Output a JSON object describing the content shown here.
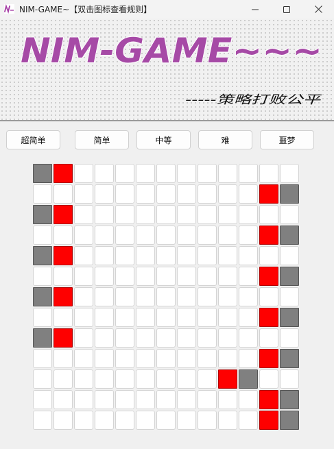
{
  "window": {
    "title": "NIM-GAME~【双击图标查看规则】",
    "icon": "nim-game-logo-icon",
    "controls": [
      "minimize-icon",
      "maximize-icon",
      "close-icon"
    ]
  },
  "banner": {
    "logo_text": "NIM-GAME~~~",
    "slogan": "-----策略打败公平"
  },
  "difficulty": {
    "buttons": [
      {
        "label": "超简单"
      },
      {
        "label": "简单"
      },
      {
        "label": "中等"
      },
      {
        "label": "难"
      },
      {
        "label": "噩梦"
      }
    ]
  },
  "board": {
    "rows": 13,
    "cols": 13,
    "colors": {
      "empty": "#ffffff",
      "piece": "#fe0000",
      "stone": "#808080"
    },
    "cells": [
      "GR...........",
      "...........RG",
      "GR...........",
      "...........RG",
      "GR...........",
      "...........RG",
      "GR...........",
      "...........RG",
      "GR...........",
      "...........RG",
      ".........RG..",
      "...........RG",
      "...........RG"
    ]
  }
}
